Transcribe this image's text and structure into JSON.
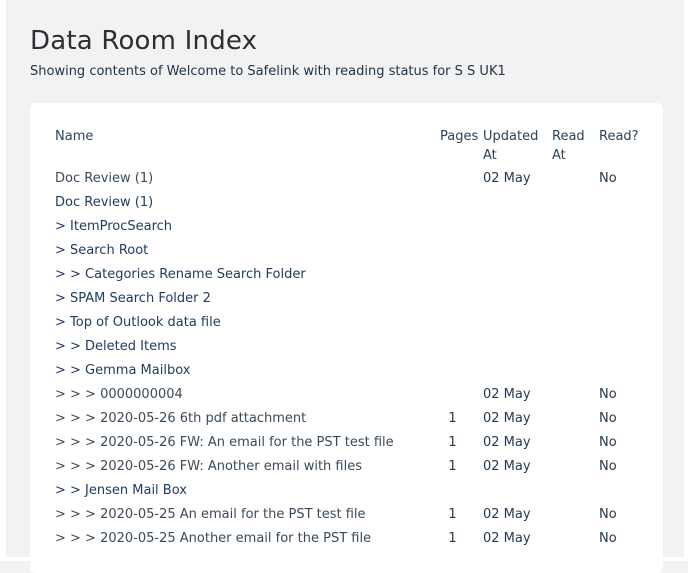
{
  "page": {
    "title": "Data Room Index",
    "subtitle": "Showing contents of Welcome to Safelink with reading status for S S UK1"
  },
  "table": {
    "headers": {
      "name": "Name",
      "pages": "Pages",
      "updated_line1": "Updated",
      "updated_line2": "At",
      "read_at_line1": "Read",
      "read_at_line2": "At",
      "read": "Read?"
    },
    "rows": [
      {
        "name": "Doc Review (1)",
        "pages": "",
        "updated": "02 May",
        "read": "No"
      },
      {
        "name": "Doc Review (1)",
        "pages": "",
        "updated": "",
        "read": ""
      },
      {
        "name": "> ItemProcSearch",
        "pages": "",
        "updated": "",
        "read": ""
      },
      {
        "name": "> Search Root",
        "pages": "",
        "updated": "",
        "read": ""
      },
      {
        "name": "> > Categories Rename Search Folder",
        "pages": "",
        "updated": "",
        "read": ""
      },
      {
        "name": "> SPAM Search Folder 2",
        "pages": "",
        "updated": "",
        "read": ""
      },
      {
        "name": "> Top of Outlook data file",
        "pages": "",
        "updated": "",
        "read": ""
      },
      {
        "name": "> > Deleted Items",
        "pages": "",
        "updated": "",
        "read": ""
      },
      {
        "name": "> > Gemma Mailbox",
        "pages": "",
        "updated": "",
        "read": ""
      },
      {
        "name": "> > > 0000000004",
        "pages": "",
        "updated": "02 May",
        "read": "No"
      },
      {
        "name": "> > > 2020-05-26 6th pdf attachment",
        "pages": "1",
        "updated": "02 May",
        "read": "No"
      },
      {
        "name": "> > > 2020-05-26 FW: An email for the PST test file",
        "pages": "1",
        "updated": "02 May",
        "read": "No"
      },
      {
        "name": "> > > 2020-05-26 FW: Another email with files",
        "pages": "1",
        "updated": "02 May",
        "read": "No"
      },
      {
        "name": "> > Jensen Mail Box",
        "pages": "",
        "updated": "",
        "read": ""
      },
      {
        "name": "> > > 2020-05-25 An email for the PST test file",
        "pages": "1",
        "updated": "02 May",
        "read": "No"
      },
      {
        "name": "> > > 2020-05-25 Another email for the PST file",
        "pages": "1",
        "updated": "02 May",
        "read": "No"
      }
    ]
  }
}
